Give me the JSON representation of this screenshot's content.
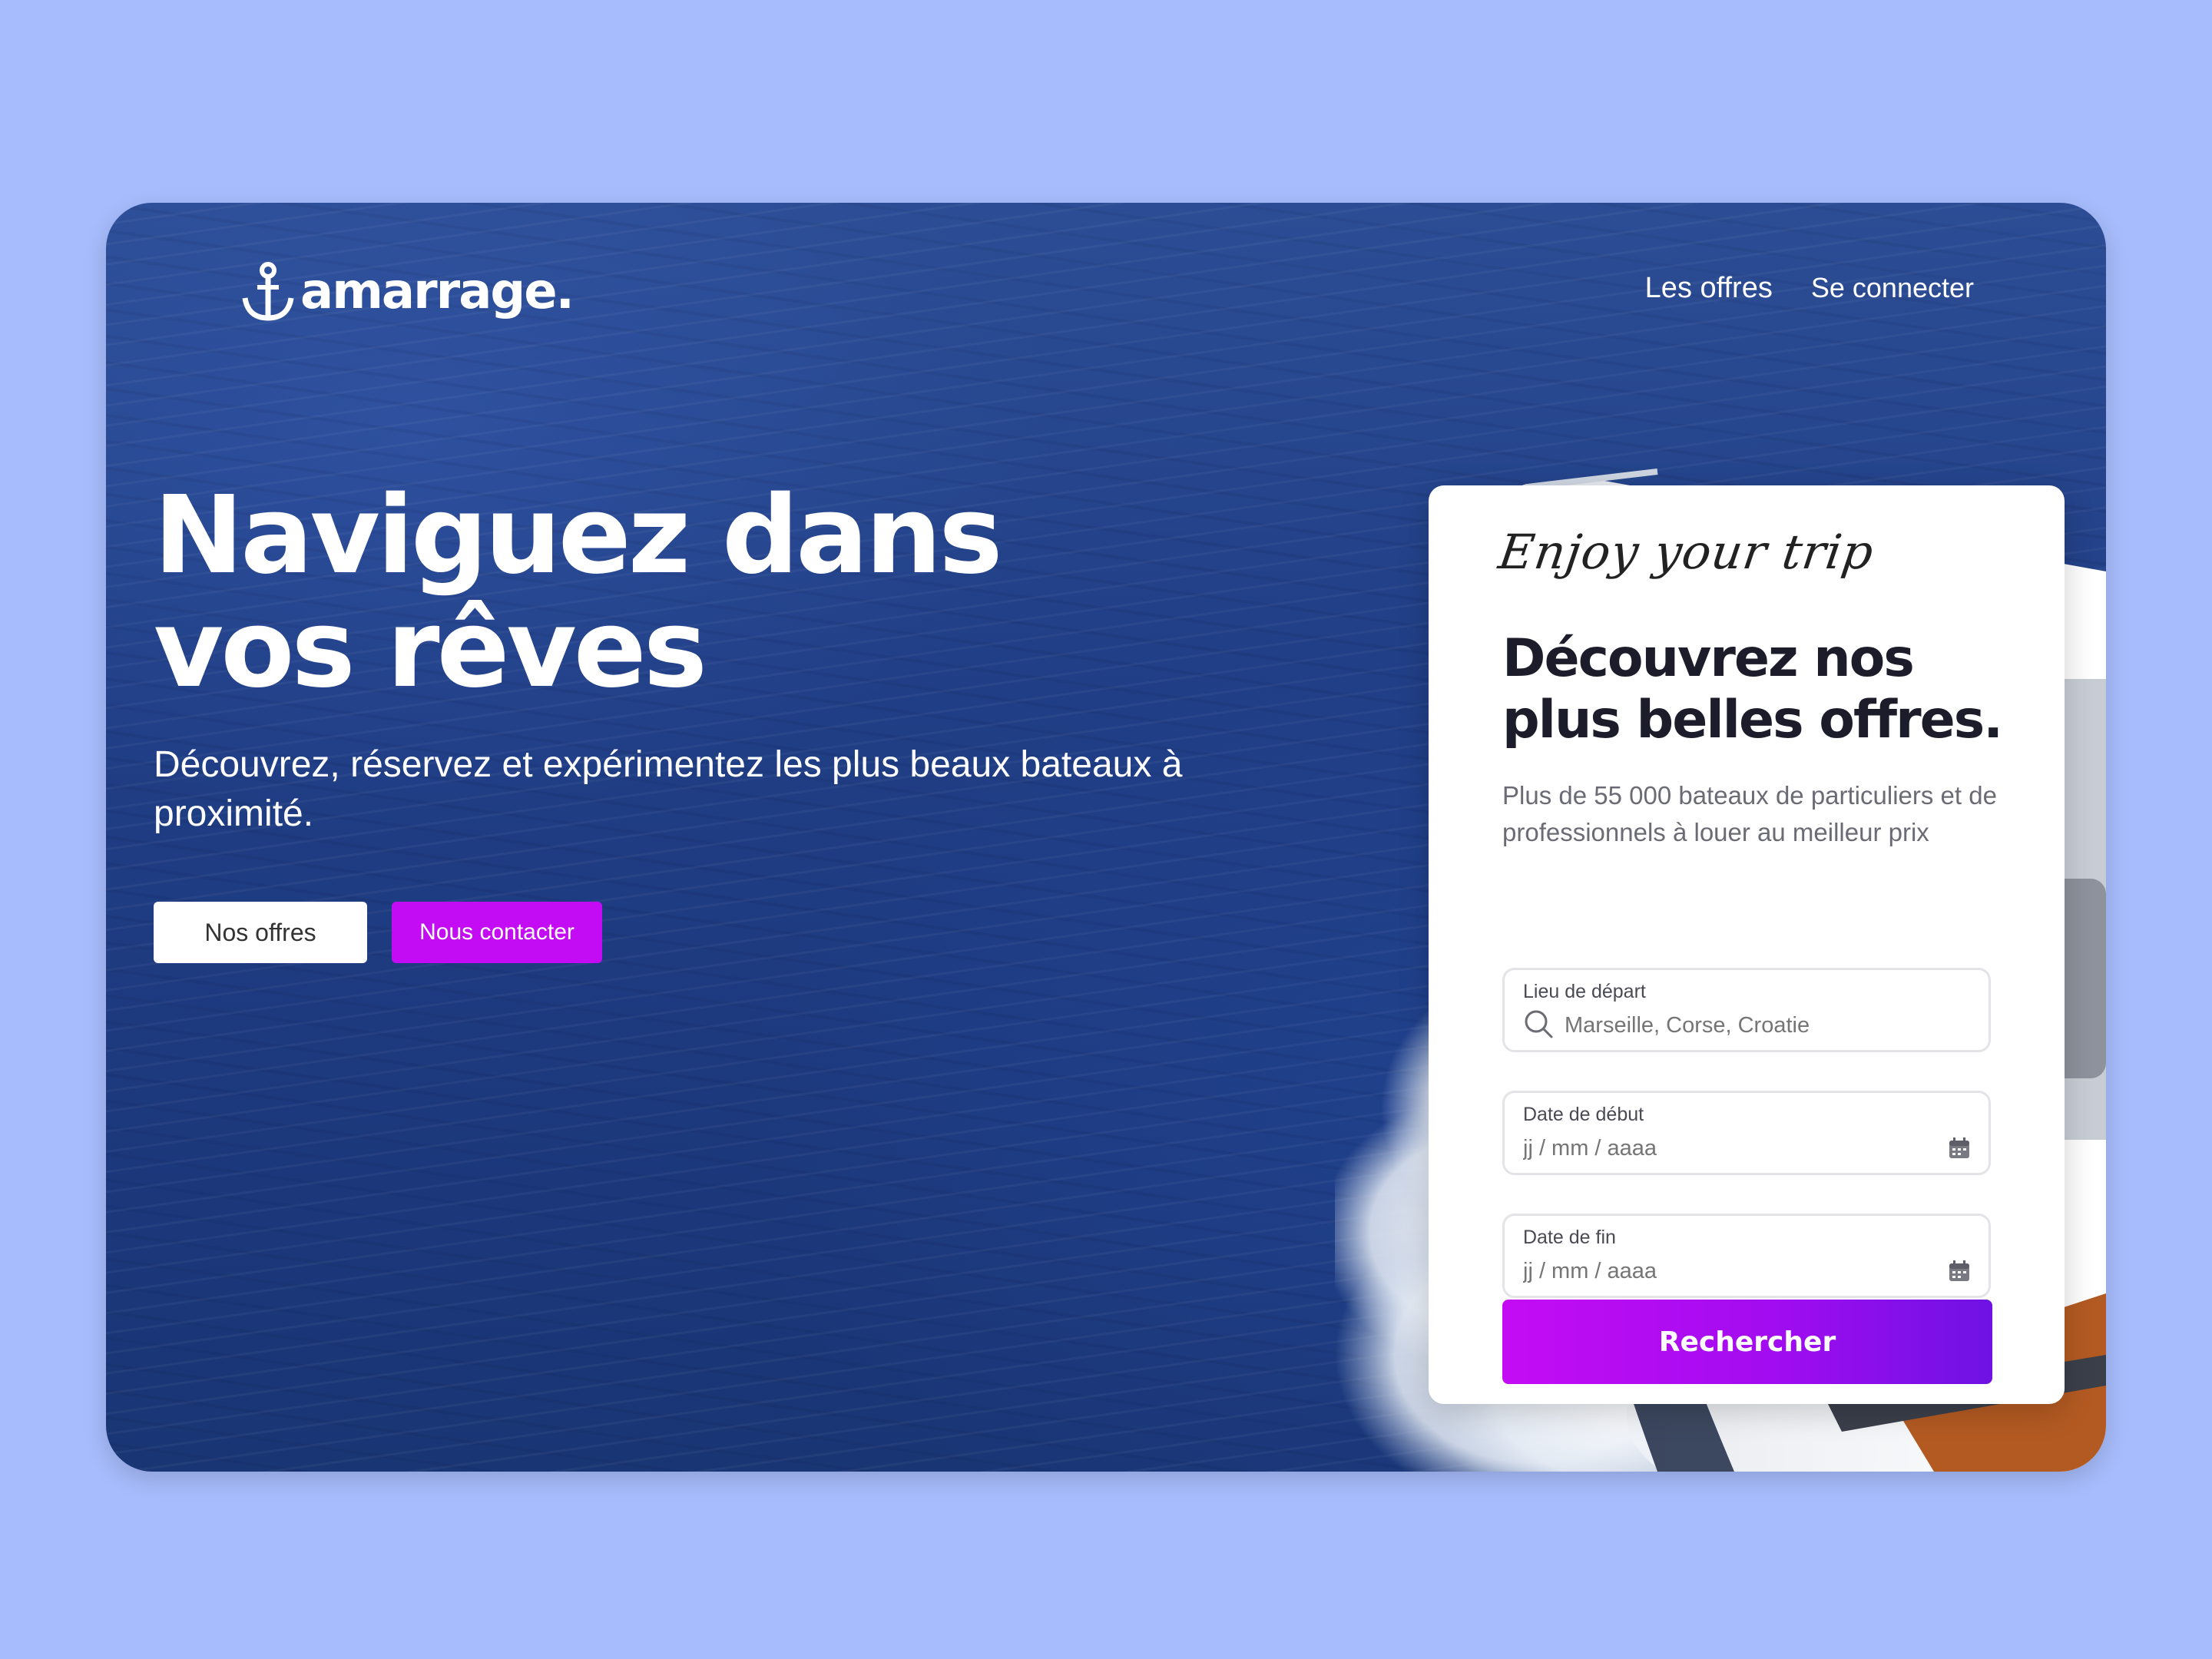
{
  "brand": {
    "name": "amarrage.",
    "icon": "anchor-icon"
  },
  "nav": {
    "offers": "Les offres",
    "login": "Se connecter"
  },
  "hero": {
    "title": "Naviguez dans vos rêves",
    "subtitle": "Découvrez, réservez et expérimentez les plus beaux bateaux à proximité.",
    "btn_offers": "Nos offres",
    "btn_contact": "Nous contacter"
  },
  "card": {
    "script": "Enjoy your trip",
    "title": "Découvrez nos plus belles offres.",
    "description": "Plus de 55 000 bateaux de particuliers et de professionnels à louer au meilleur prix",
    "fields": {
      "departure": {
        "label": "Lieu de départ",
        "placeholder": "Marseille, Corse, Croatie",
        "value": "",
        "icon": "search-icon"
      },
      "start": {
        "label": "Date de début",
        "placeholder": "jj / mm / aaaa",
        "value": "",
        "icon": "calendar-icon"
      },
      "end": {
        "label": "Date de fin",
        "placeholder": "jj / mm / aaaa",
        "value": "",
        "icon": "calendar-icon"
      }
    },
    "submit": "Rechercher"
  },
  "colors": {
    "page_background": "#a7bcfc",
    "accent_purple": "#c30cf3",
    "gradient_end": "#6e12e3",
    "sea_blue": "#213f86"
  }
}
